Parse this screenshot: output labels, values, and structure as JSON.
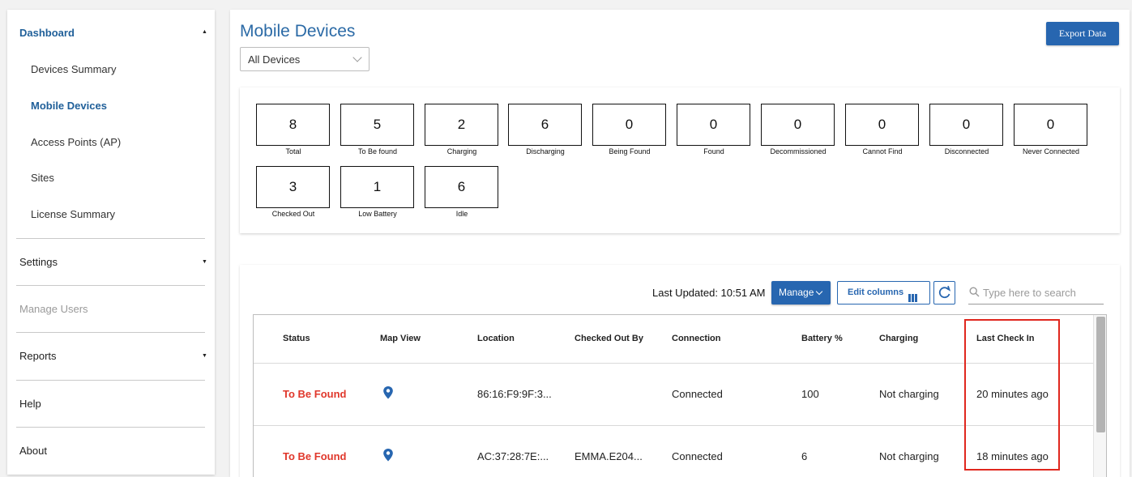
{
  "sidebar": {
    "dashboard": "Dashboard",
    "sub_items": [
      "Devices Summary",
      "Mobile Devices",
      "Access Points (AP)",
      "Sites",
      "License Summary"
    ],
    "settings": "Settings",
    "manage_users": "Manage Users",
    "reports": "Reports",
    "help": "Help",
    "about": "About",
    "caret_up": "▲",
    "caret_down": "▼"
  },
  "header": {
    "title": "Mobile Devices",
    "device_filter": "All Devices",
    "export_label": "Export Data"
  },
  "stats": [
    {
      "value": "8",
      "label": "Total"
    },
    {
      "value": "5",
      "label": "To Be found"
    },
    {
      "value": "2",
      "label": "Charging"
    },
    {
      "value": "6",
      "label": "Discharging"
    },
    {
      "value": "0",
      "label": "Being Found"
    },
    {
      "value": "0",
      "label": "Found"
    },
    {
      "value": "0",
      "label": "Decommissioned"
    },
    {
      "value": "0",
      "label": "Cannot Find"
    },
    {
      "value": "0",
      "label": "Disconnected"
    },
    {
      "value": "0",
      "label": "Never Connected"
    },
    {
      "value": "3",
      "label": "Checked Out"
    },
    {
      "value": "1",
      "label": "Low Battery"
    },
    {
      "value": "6",
      "label": "Idle"
    }
  ],
  "toolbar": {
    "last_updated": "Last Updated: 10:51 AM",
    "manage_label": "Manage",
    "edit_columns_label": "Edit columns",
    "search_placeholder": "Type here to search"
  },
  "table": {
    "columns": [
      "Status",
      "Map View",
      "Location",
      "Checked Out By",
      "Connection",
      "Battery %",
      "Charging",
      "Last Check In"
    ],
    "rows": [
      {
        "status": "To Be Found",
        "location": "86:16:F9:9F:3...",
        "checked_out_by": "",
        "connection": "Connected",
        "battery": "100",
        "charging": "Not charging",
        "last_check_in": "20 minutes ago"
      },
      {
        "status": "To Be Found",
        "location": "AC:37:28:7E:...",
        "checked_out_by": "EMMA.E204...",
        "connection": "Connected",
        "battery": "6",
        "charging": "Not charging",
        "last_check_in": "18 minutes ago"
      }
    ]
  },
  "colors": {
    "accent": "#2766b0",
    "status_red": "#e0372b",
    "highlight": "#e0271e"
  }
}
